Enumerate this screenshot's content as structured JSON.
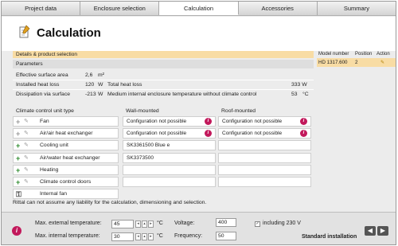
{
  "tabs": [
    {
      "label": "Project data",
      "active": false
    },
    {
      "label": "Enclosure selection",
      "active": false
    },
    {
      "label": "Calculation",
      "active": true
    },
    {
      "label": "Accessories",
      "active": false
    },
    {
      "label": "Summary",
      "active": false
    }
  ],
  "header": {
    "title": "Calculation",
    "icon": "document-icon"
  },
  "left": {
    "details_label": "Details & product selection",
    "parameters_label": "Parameters",
    "surface_area_label": "Effective surface area",
    "surface_area_value": "2,6",
    "surface_area_unit": "m²",
    "installed_heat_loss_label": "Installed heat loss",
    "installed_heat_loss_value": "120",
    "installed_heat_loss_unit": "W",
    "total_heat_loss_label": "Total heat loss",
    "total_heat_loss_value": "333 W",
    "dissipation_label": "Dissipation via surface",
    "dissipation_value": "-213",
    "dissipation_unit": "W",
    "medium_temp_label": "Medium internal enclosure temperature without climate control",
    "medium_temp_value": "53",
    "medium_temp_unit": "°C"
  },
  "table": {
    "col_unit_type": "Climate control unit type",
    "col_wall": "Wall-mounted",
    "col_roof": "Roof-mounted",
    "rows": [
      {
        "label": "Fan",
        "plus_color": "#999999",
        "wall": "Configuration not possible",
        "wall_info": true,
        "roof": "Configuration not possible",
        "roof_info": true
      },
      {
        "label": "Air/air heat exchanger",
        "plus_color": "#999999",
        "wall": "Configuration not possible",
        "wall_info": true,
        "roof": "Configuration not possible",
        "roof_info": true
      },
      {
        "label": "Cooling unit",
        "plus_color": "#2e8b2e",
        "wall": "SK3361500 Blue e",
        "wall_info": false,
        "roof": "",
        "roof_info": false
      },
      {
        "label": "Air/water heat exchanger",
        "plus_color": "#2e8b2e",
        "wall": "SK3373500",
        "wall_info": false,
        "roof": "",
        "roof_info": false
      },
      {
        "label": "Heating",
        "plus_color": "#2e8b2e",
        "wall": "",
        "wall_info": false,
        "roof": "",
        "roof_info": false
      },
      {
        "label": "Climate control doors",
        "plus_color": "#2e8b2e",
        "wall": "",
        "wall_info": false,
        "roof": "",
        "roof_info": false
      },
      {
        "label": "Internal fan",
        "plus_color": "#555555",
        "wall": "",
        "wall_info": false,
        "roof": "",
        "roof_info": false
      }
    ]
  },
  "disclaimer": "Rittal can not assume any liability for the calculation, dimensioning and selection.",
  "right": {
    "col_model": "Model number",
    "col_position": "Position",
    "col_action": "Action",
    "model": "HD 1317.600",
    "position": "2",
    "action_icon": "pencil-icon"
  },
  "footer": {
    "max_ext_label": "Max. external temperature:",
    "max_ext_value": "45",
    "max_ext_unit": "°C",
    "max_int_label": "Max. internal temperature:",
    "max_int_value": "30",
    "max_int_unit": "°C",
    "voltage_label": "Voltage:",
    "voltage_value": "400",
    "frequency_label": "Frequency:",
    "frequency_value": "50",
    "including_label": "including 230 V",
    "standard_label": "Standard installation"
  },
  "colors": {
    "accent": "#c2185b",
    "highlight": "#f8dca4"
  }
}
